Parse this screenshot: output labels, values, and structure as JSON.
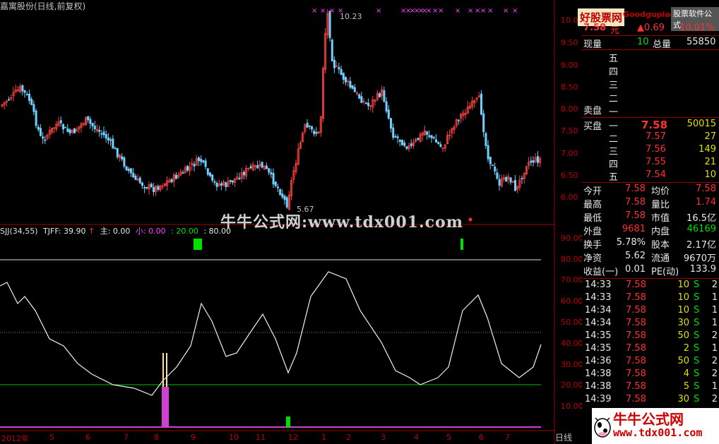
{
  "header": {
    "title": "嘉寓股份(日线,前复权)"
  },
  "indicator_header": {
    "name": "SJJ(34,55)",
    "tjff_label": "TJFF: 39.90",
    "arrow": "↑",
    "zhu_label": "主: 0.00",
    "xiao_label": "小: 0.00",
    "v20_label": ": 20.00",
    "v80_label": ": 80.00"
  },
  "watermark": "牛牛公式网:www.tdx001.com",
  "price_axis": [
    "10.00",
    "9.50",
    "9.00",
    "8.50",
    "8.00",
    "7.50",
    "7.00",
    "6.50",
    "6.00"
  ],
  "ind_axis": [
    "90.00",
    "80.00",
    "70.00",
    "60.00",
    "50.00",
    "40.00",
    "30.00",
    "20.00",
    "10.00"
  ],
  "annotations": {
    "high": "10.23",
    "low": "5.67"
  },
  "x_labels": [
    "2012年",
    "5",
    "6",
    "7",
    "8",
    "9",
    "10",
    "11",
    "12",
    "1",
    "2",
    "3",
    "4",
    "5",
    "6",
    "7"
  ],
  "day_label": "日线",
  "side": {
    "brand_left": "好股票网",
    "brand_mid": "Goodgupiao.com",
    "brand_right": "股票软件公式",
    "price": "7.58",
    "unit": "元",
    "change": "▲0.69",
    "change_pct": "10.01%",
    "xianliang_label": "现量",
    "xianliang_value": "10",
    "zongliang_label": "总量",
    "zongliang_value": "55850",
    "sell_levels": [
      "五",
      "四",
      "三",
      "二",
      "一"
    ],
    "maipan_label": "卖盘",
    "buy_label": "买盘",
    "buy": [
      {
        "lvl": "一",
        "price": "7.58",
        "vol": "50015"
      },
      {
        "lvl": "二",
        "price": "7.57",
        "vol": "27"
      },
      {
        "lvl": "三",
        "price": "7.56",
        "vol": "149"
      },
      {
        "lvl": "四",
        "price": "7.55",
        "vol": "21"
      },
      {
        "lvl": "五",
        "price": "7.54",
        "vol": "10"
      }
    ],
    "stats": [
      [
        "今开",
        "7.58",
        "均价",
        "7.58"
      ],
      [
        "最高",
        "7.58",
        "量比",
        "1.74"
      ],
      [
        "最低",
        "7.58",
        "市值",
        "16.5亿"
      ],
      [
        "外盘",
        "9681",
        "内盘",
        "46169"
      ],
      [
        "换手",
        "5.78%",
        "股本",
        "2.17亿"
      ],
      [
        "净资",
        "5.62",
        "流通",
        "9670万"
      ],
      [
        "收益(一)",
        "0.01",
        "PE(动)",
        "133.9"
      ]
    ],
    "ticks": [
      [
        "14:33",
        "7.58",
        "10",
        "S",
        "2"
      ],
      [
        "14:33",
        "7.58",
        "10",
        "S",
        "1"
      ],
      [
        "14:34",
        "7.58",
        "10",
        "S",
        "1"
      ],
      [
        "14:34",
        "7.58",
        "30",
        "S",
        "1"
      ],
      [
        "14:35",
        "7.58",
        "50",
        "S",
        "2"
      ],
      [
        "14:35",
        "7.58",
        "2",
        "S",
        "1"
      ],
      [
        "14:36",
        "7.58",
        "50",
        "S",
        "2"
      ],
      [
        "14:38",
        "7.58",
        "4",
        "S",
        "2"
      ],
      [
        "14:38",
        "7.58",
        "5",
        "S",
        "1"
      ],
      [
        "14:39",
        "7.58",
        "30",
        "S",
        "2"
      ]
    ]
  },
  "bottom_logo": {
    "line1": "牛牛公式网",
    "line2": "www.tdx001.com"
  }
}
